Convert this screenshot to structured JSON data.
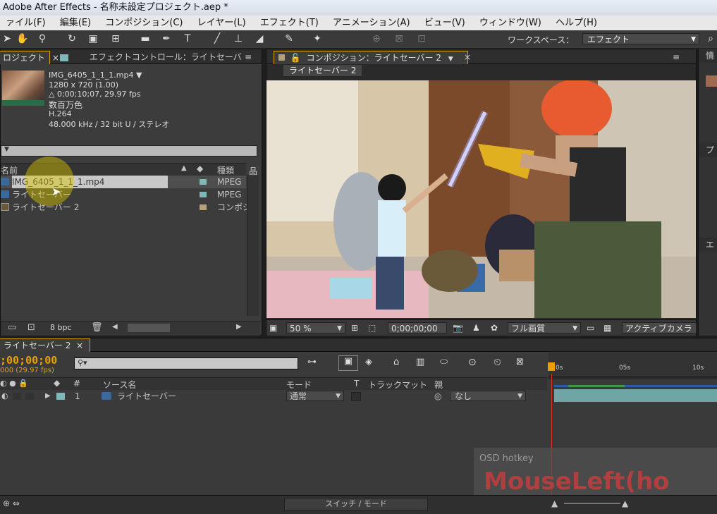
{
  "window": {
    "title": "Adobe After Effects - 名称未設定プロジェクト.aep *"
  },
  "menu": [
    "ァイル(F)",
    "編集(E)",
    "コンポジション(C)",
    "レイヤー(L)",
    "エフェクト(T)",
    "アニメーション(A)",
    "ビュー(V)",
    "ウィンドウ(W)",
    "ヘルプ(H)"
  ],
  "toolbar": {
    "workspace_label": "ワークスペース：",
    "workspace_value": "エフェクト"
  },
  "project": {
    "tab_label": "ロジェクト",
    "effect_tab": "エフェクトコントロール：ライトセーバ",
    "file_name": "IMG_6405_1_1_1.mp4 ▼",
    "resolution": "1280 x 720 (1.00)",
    "duration": "△ 0;00;10;07, 29.97 fps",
    "colors": "数百万色",
    "codec": "H.264",
    "audio": "48.000 kHz / 32 bit U / ステレオ",
    "col_name": "名前",
    "col_type": "種類",
    "items": [
      {
        "name": "IMG_6405_1_1_1.mp4",
        "type": "MPEG",
        "color": "#7fb8b8",
        "icon": "video-file-icon"
      },
      {
        "name": "ライトセーバー",
        "type": "MPEG",
        "color": "#7fb8b8",
        "icon": "video-file-icon"
      },
      {
        "name": "ライトセーバー 2",
        "type": "コンポジ",
        "color": "#b8a07a",
        "icon": "composition-icon"
      }
    ],
    "bpc": "8 bpc"
  },
  "comp": {
    "tab_label": "コンポジション：ライトセーバー 2",
    "comp_name": "ライトセーバー 2",
    "zoom": "50 %",
    "timecode": "0;00;00;00",
    "resolution": "フル画質",
    "camera": "アクティブカメラ"
  },
  "timeline": {
    "tab_label": "ライトセーバー 2",
    "timecode": ";00;00;00",
    "fps": "000 (29.97 fps)",
    "search_placeholder": "",
    "col_source": "ソース名",
    "col_mode": "モード",
    "col_t": "T",
    "col_trackmatte": "トラックマット",
    "col_parent": "親",
    "layer": {
      "number": "1",
      "name": "ライトセーバー",
      "mode": "通常",
      "parent": "なし"
    },
    "ruler": [
      "0s",
      "05s",
      "10s"
    ],
    "switch_mode": "スイッチ / モード"
  },
  "overlay": {
    "small": "OSD hotkey",
    "big": "MouseLeft(ho"
  },
  "accent_color": "#e8a000"
}
